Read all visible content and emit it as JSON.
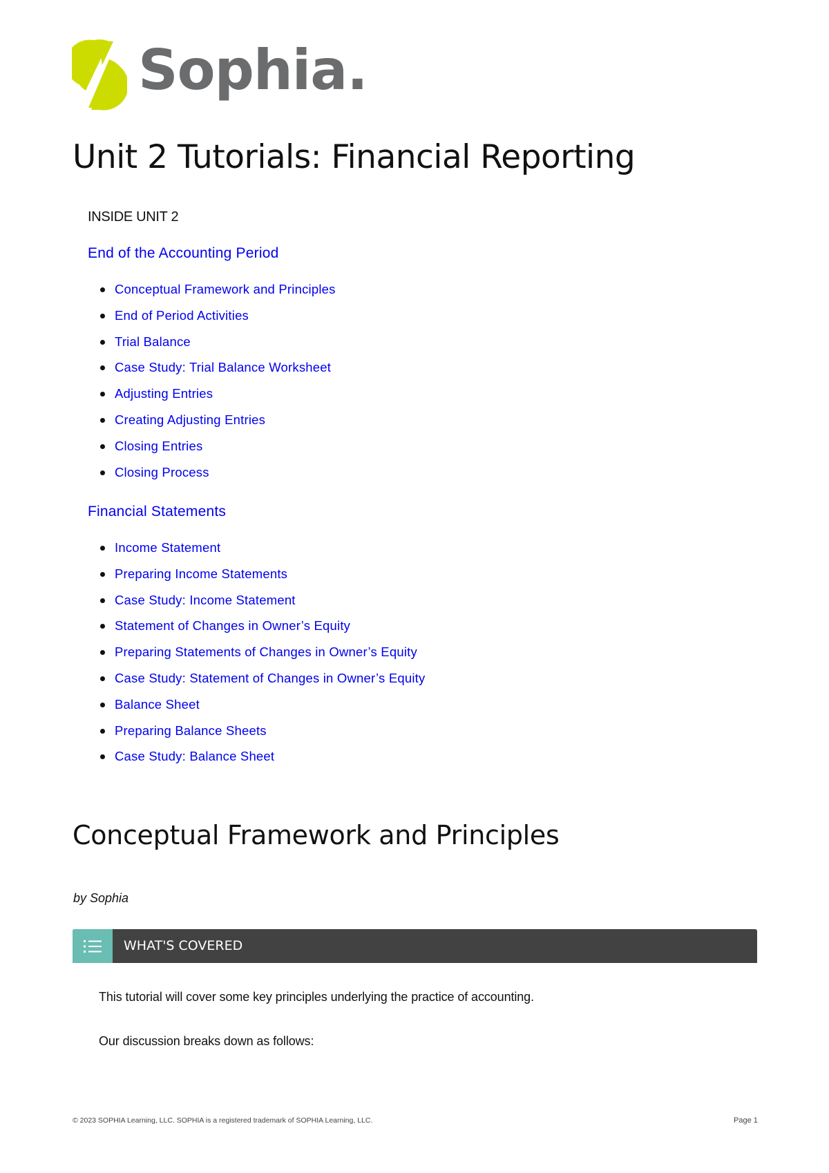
{
  "brand": {
    "name": "Sophia.",
    "logo_icon": "sophia-leaf-icon",
    "mark_color": "#cddc00",
    "wordmark_color": "#6b6c6e"
  },
  "document": {
    "title": "Unit 2 Tutorials: Financial Reporting",
    "inside_label": "INSIDE UNIT 2",
    "link_color": "#0000ee",
    "sections": [
      {
        "title": "End of the Accounting Period",
        "items": [
          "Conceptual Framework and Principles",
          "End of Period Activities",
          "Trial Balance",
          "Case Study: Trial Balance Worksheet",
          "Adjusting Entries",
          "Creating Adjusting Entries",
          "Closing Entries",
          "Closing Process"
        ]
      },
      {
        "title": "Financial Statements",
        "items": [
          "Income Statement",
          "Preparing Income Statements",
          "Case Study: Income Statement",
          "Statement of Changes in Owner’s Equity",
          "Preparing Statements of Changes in Owner’s Equity",
          "Case Study: Statement of Changes in Owner’s Equity",
          "Balance Sheet",
          "Preparing Balance Sheets",
          "Case Study: Balance Sheet"
        ]
      }
    ]
  },
  "lesson": {
    "title": "Conceptual Framework and Principles",
    "author": "by Sophia",
    "covered": {
      "icon": "list-icon",
      "label": "WHAT'S COVERED",
      "icon_bg": "#69bdb2",
      "bar_bg": "#424242"
    },
    "paragraphs": [
      "This tutorial will cover some key principles underlying the practice of accounting.",
      "Our discussion breaks down as follows:"
    ]
  },
  "footer": {
    "copyright": "© 2023 SOPHIA Learning, LLC. SOPHIA is a registered trademark of SOPHIA Learning, LLC.",
    "page": "Page 1"
  }
}
